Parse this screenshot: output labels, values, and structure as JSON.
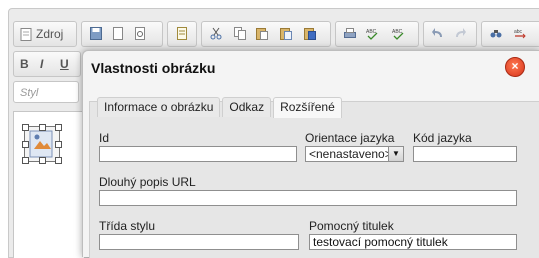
{
  "toolbar": {
    "source_label": "Zdroj",
    "icons": [
      "save-icon",
      "new-page-icon",
      "preview-icon",
      "templates-icon",
      "cut-icon",
      "copy-icon",
      "paste-icon",
      "paste-text-icon",
      "paste-word-icon",
      "print-icon",
      "spellcheck-icon",
      "spellcheck-dropdown-icon",
      "undo-icon",
      "redo-icon",
      "find-icon",
      "replace-icon"
    ],
    "format_buttons": [
      "B",
      "I",
      "U"
    ],
    "styles_placeholder": "Styl"
  },
  "dialog": {
    "title": "Vlastnosti obrázku",
    "close_icon": "close-icon",
    "tabs": [
      {
        "label": "Informace o obrázku"
      },
      {
        "label": "Odkaz"
      },
      {
        "label": "Rozšířené",
        "active": true
      }
    ],
    "fields": {
      "id": {
        "label": "Id",
        "value": ""
      },
      "language_direction": {
        "label": "Orientace jazyka",
        "value": "<nenastaveno>"
      },
      "language_code": {
        "label": "Kód jazyka",
        "value": ""
      },
      "long_description_url": {
        "label": "Dlouhý popis URL",
        "value": ""
      },
      "style_class": {
        "label": "Třída stylu",
        "value": ""
      },
      "advisory_title": {
        "label": "Pomocný titulek",
        "value": "testovací pomocný titulek"
      }
    }
  },
  "colors": {
    "close_button": "#e0401f",
    "dialog_bg": "#f4f4f4",
    "body_bg": "#e6e6e6"
  }
}
